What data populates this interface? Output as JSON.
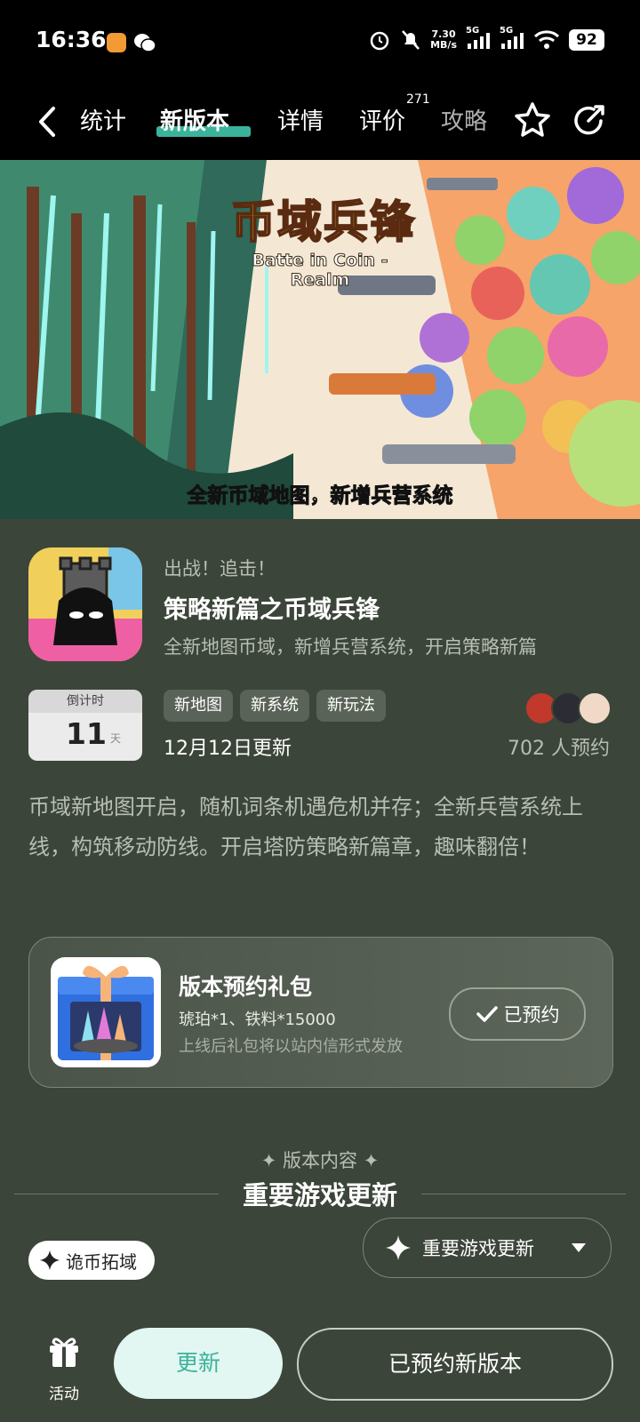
{
  "status_bar": {
    "time": "16:36",
    "net_speed_value": "7.30",
    "net_speed_unit": "MB/s",
    "signal1": "5G",
    "signal2": "5G",
    "battery": "92"
  },
  "nav": {
    "tabs": [
      {
        "label": "统计"
      },
      {
        "label": "新版本"
      },
      {
        "label": "详情"
      },
      {
        "label": "评价"
      },
      {
        "label": "攻略"
      }
    ],
    "review_count": "271",
    "accent": "#3bb39b"
  },
  "banner": {
    "title": "币域兵锋",
    "subtitle": "Batte in Coin - Realm",
    "caption": "全新币域地图，新增兵营系统"
  },
  "version": {
    "pretitle": "出战！追击！",
    "title": "策略新篇之币域兵锋",
    "subtitle": "全新地图币域，新增兵营系统，开启策略新篇",
    "countdown_label": "倒计时",
    "countdown_value": "11",
    "countdown_unit": "天",
    "tags": [
      "新地图",
      "新系统",
      "新玩法"
    ],
    "update_date": "12月12日更新",
    "reservations": "702 人预约",
    "description": "币域新地图开启，随机词条机遇危机并存；全新兵营系统上线，构筑移动防线。开启塔防策略新篇章，趣味翻倍！"
  },
  "gift": {
    "title": "版本预约礼包",
    "items": "琥珀*1、铁料*15000",
    "note": "上线后礼包将以站内信形式发放",
    "button_label": "已预约"
  },
  "content": {
    "kicker": "版本内容",
    "section_title": "重要游戏更新",
    "dropdown_label": "重要游戏更新",
    "chip_label": "诡币拓域"
  },
  "bottom": {
    "activity_label": "活动",
    "update_label": "更新",
    "preordered_label": "已预约新版本"
  }
}
